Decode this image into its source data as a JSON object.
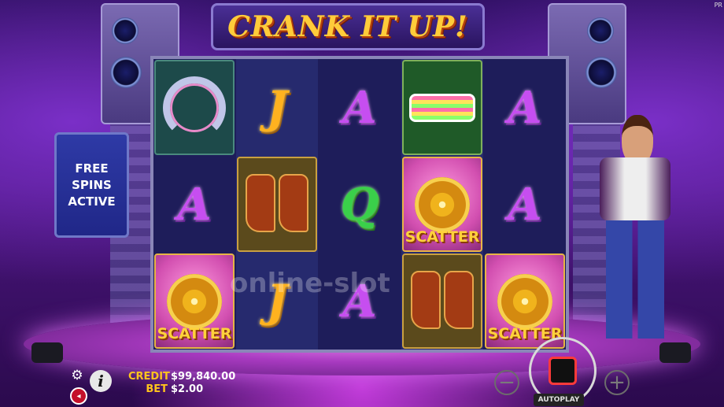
{
  "game": {
    "title": "CRANK IT UP!",
    "brand": "PR"
  },
  "free_spins_panel": {
    "line1": "FREE",
    "line2": "SPINS",
    "line3": "ACTIVE"
  },
  "reels": [
    [
      {
        "symbol": "headphones"
      },
      {
        "symbol": "letter",
        "text": "A"
      },
      {
        "symbol": "scatter",
        "text": "SCATTER"
      }
    ],
    [
      {
        "symbol": "letter",
        "text": "J"
      },
      {
        "symbol": "boots"
      },
      {
        "symbol": "letter",
        "text": "J"
      }
    ],
    [
      {
        "symbol": "letter",
        "text": "A"
      },
      {
        "symbol": "letter",
        "text": "Q"
      },
      {
        "symbol": "letter",
        "text": "A"
      }
    ],
    [
      {
        "symbol": "glasses"
      },
      {
        "symbol": "scatter",
        "text": "SCATTER"
      },
      {
        "symbol": "boots"
      }
    ],
    [
      {
        "symbol": "letter",
        "text": "A"
      },
      {
        "symbol": "letter",
        "text": "A"
      },
      {
        "symbol": "scatter",
        "text": "SCATTER"
      }
    ]
  ],
  "watermark": "online-slot",
  "balance": {
    "credit_label": "CREDIT",
    "credit_value": "$99,840.00",
    "bet_label": "BET",
    "bet_value": "$2.00"
  },
  "controls": {
    "settings_icon": "gear-icon",
    "info_icon": "info-icon",
    "info_glyph": "i",
    "sound_icon": "sound-icon",
    "minus_glyph": "−",
    "plus_glyph": "+",
    "autoplay_label": "AUTOPLAY"
  },
  "colors": {
    "gold": "#ffc41d",
    "scatter_pink": "#d24fb0",
    "panel_blue": "#2e3aa6"
  }
}
